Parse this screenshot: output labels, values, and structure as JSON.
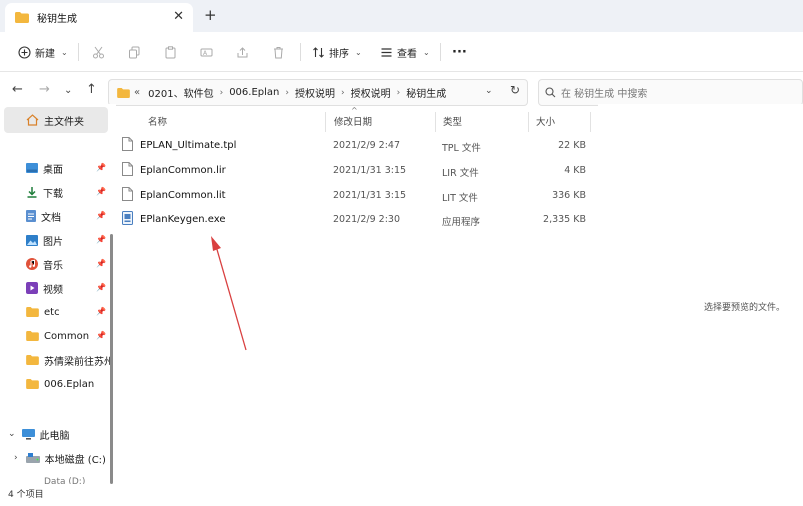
{
  "window": {
    "tab_title": "秘钥生成",
    "close_glyph": "✕",
    "newtab_glyph": "+"
  },
  "commandbar": {
    "new_label": "新建",
    "sort_label": "排序",
    "view_label": "查看",
    "more_glyph": "···"
  },
  "address": {
    "overflow": "«",
    "crumbs": [
      "0201、软件包",
      "006.Eplan",
      "授权说明",
      "授权说明",
      "秘钥生成"
    ],
    "search_placeholder": "在 秘钥生成 中搜索"
  },
  "sidebar": {
    "home": "主文件夹",
    "items": [
      {
        "label": "桌面",
        "icon": "desktop-icon",
        "pinned": true
      },
      {
        "label": "下载",
        "icon": "download-icon",
        "pinned": true
      },
      {
        "label": "文档",
        "icon": "document-icon",
        "pinned": true
      },
      {
        "label": "图片",
        "icon": "pictures-icon",
        "pinned": true
      },
      {
        "label": "音乐",
        "icon": "music-icon",
        "pinned": true
      },
      {
        "label": "视频",
        "icon": "video-icon",
        "pinned": true
      },
      {
        "label": "etc",
        "icon": "folder-icon",
        "pinned": true
      },
      {
        "label": "Common",
        "icon": "folder-icon",
        "pinned": true
      },
      {
        "label": "苏倩梁前往苏州",
        "icon": "folder-icon",
        "pinned": false
      },
      {
        "label": "006.Eplan",
        "icon": "folder-icon",
        "pinned": false
      }
    ],
    "this_pc": "此电脑",
    "local_disk": "本地磁盘 (C:)",
    "data_disk": "Data (D:)"
  },
  "columns": {
    "name": "名称",
    "modified": "修改日期",
    "type": "类型",
    "size": "大小"
  },
  "files": [
    {
      "name": "EPLAN_Ultimate.tpl",
      "modified": "2021/2/9 2:47",
      "type": "TPL 文件",
      "size": "22 KB",
      "icon": "file-icon"
    },
    {
      "name": "EplanCommon.lir",
      "modified": "2021/1/31 3:15",
      "type": "LIR 文件",
      "size": "4 KB",
      "icon": "file-icon"
    },
    {
      "name": "EplanCommon.lit",
      "modified": "2021/1/31 3:15",
      "type": "LIT 文件",
      "size": "336 KB",
      "icon": "file-icon"
    },
    {
      "name": "EPlanKeygen.exe",
      "modified": "2021/2/9 2:30",
      "type": "应用程序",
      "size": "2,335 KB",
      "icon": "exe-icon"
    }
  ],
  "preview_text": "选择要预览的文件。",
  "status": "4 个项目",
  "colors": {
    "accent": "#0067c0",
    "folder": "#f3b73e",
    "annotation_arrow": "#d94040"
  }
}
